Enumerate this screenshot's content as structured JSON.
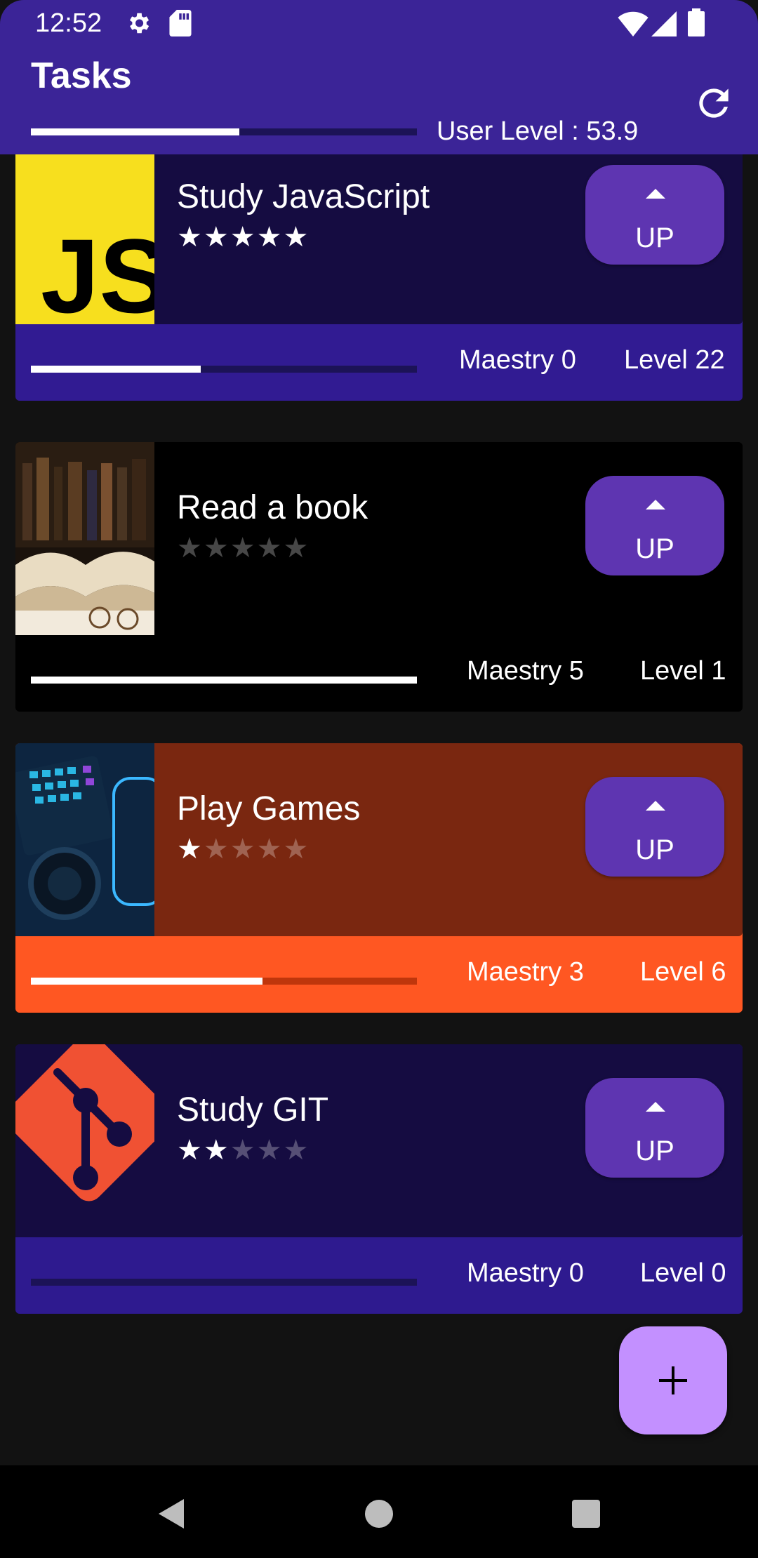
{
  "status_bar": {
    "time": "12:52"
  },
  "app_bar": {
    "title": "Tasks",
    "user_level_text": "User Level : 53.9",
    "user_level_progress": 0.54
  },
  "tasks": [
    {
      "name": "Study JavaScript",
      "stars": 5,
      "up_label": "UP",
      "maestry": "Maestry 0",
      "level": "Level 22",
      "progress": 0.44,
      "thumb": "javascript-logo",
      "colors": {
        "top": "#150c41",
        "bottom": "#311b92",
        "track": "#1c1357"
      }
    },
    {
      "name": "Read a book",
      "stars": 0,
      "up_label": "UP",
      "maestry": "Maestry 5",
      "level": "Level 1",
      "progress": 1.0,
      "thumb": "book-photo",
      "colors": {
        "top": "#000000",
        "bottom": "#000000",
        "track": "#222222"
      }
    },
    {
      "name": "Play Games",
      "stars": 1,
      "up_label": "UP",
      "maestry": "Maestry 3",
      "level": "Level 6",
      "progress": 0.6,
      "thumb": "gaming-photo",
      "colors": {
        "top": "#7a2710",
        "bottom": "#ff5722",
        "track": "#bf360c"
      }
    },
    {
      "name": "Study GIT",
      "stars": 2,
      "up_label": "UP",
      "maestry": "Maestry 0",
      "level": "Level 0",
      "progress": 0.0,
      "thumb": "git-logo",
      "colors": {
        "top": "#150c41",
        "bottom": "#2e1a8f",
        "track": "#1c1357"
      }
    }
  ],
  "fab": {
    "label": "+"
  }
}
